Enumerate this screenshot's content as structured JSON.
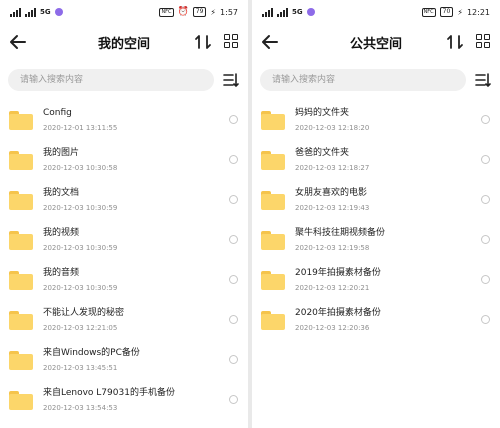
{
  "left": {
    "status": {
      "carrier": "5G",
      "time": "1:57",
      "battery": "79"
    },
    "title": "我的空间",
    "search_placeholder": "请输入搜索内容",
    "items": [
      {
        "name": "Config",
        "date": "2020-12-01 13:11:55"
      },
      {
        "name": "我的图片",
        "date": "2020-12-03 10:30:58"
      },
      {
        "name": "我的文档",
        "date": "2020-12-03 10:30:59"
      },
      {
        "name": "我的视频",
        "date": "2020-12-03 10:30:59"
      },
      {
        "name": "我的音频",
        "date": "2020-12-03 10:30:59"
      },
      {
        "name": "不能让人发现的秘密",
        "date": "2020-12-03 12:21:05"
      },
      {
        "name": "来自Windows的PC备份",
        "date": "2020-12-03 13:45:51"
      },
      {
        "name": "来自Lenovo L79031的手机备份",
        "date": "2020-12-03 13:54:53"
      }
    ]
  },
  "right": {
    "status": {
      "carrier": "5G",
      "time": "12:21",
      "battery": "70"
    },
    "title": "公共空间",
    "search_placeholder": "请输入搜索内容",
    "items": [
      {
        "name": "妈妈的文件夹",
        "date": "2020-12-03 12:18:20"
      },
      {
        "name": "爸爸的文件夹",
        "date": "2020-12-03 12:18:27"
      },
      {
        "name": "女朋友喜欢的电影",
        "date": "2020-12-03 12:19:43"
      },
      {
        "name": "聚牛科技往期视频备份",
        "date": "2020-12-03 12:19:58"
      },
      {
        "name": "2019年拍摄素材备份",
        "date": "2020-12-03 12:20:21"
      },
      {
        "name": "2020年拍摄素材备份",
        "date": "2020-12-03 12:20:36"
      }
    ]
  },
  "icons": {
    "back": "arrow-left-icon",
    "sort": "sort-icon",
    "grid": "grid-view-icon",
    "filter": "filter-icon",
    "folder": "folder-icon"
  },
  "colors": {
    "folder": "#fcd66a",
    "folder_tab": "#f5c44c",
    "status_dot": "#8d6be8",
    "search_bg": "#f0f0f0"
  }
}
